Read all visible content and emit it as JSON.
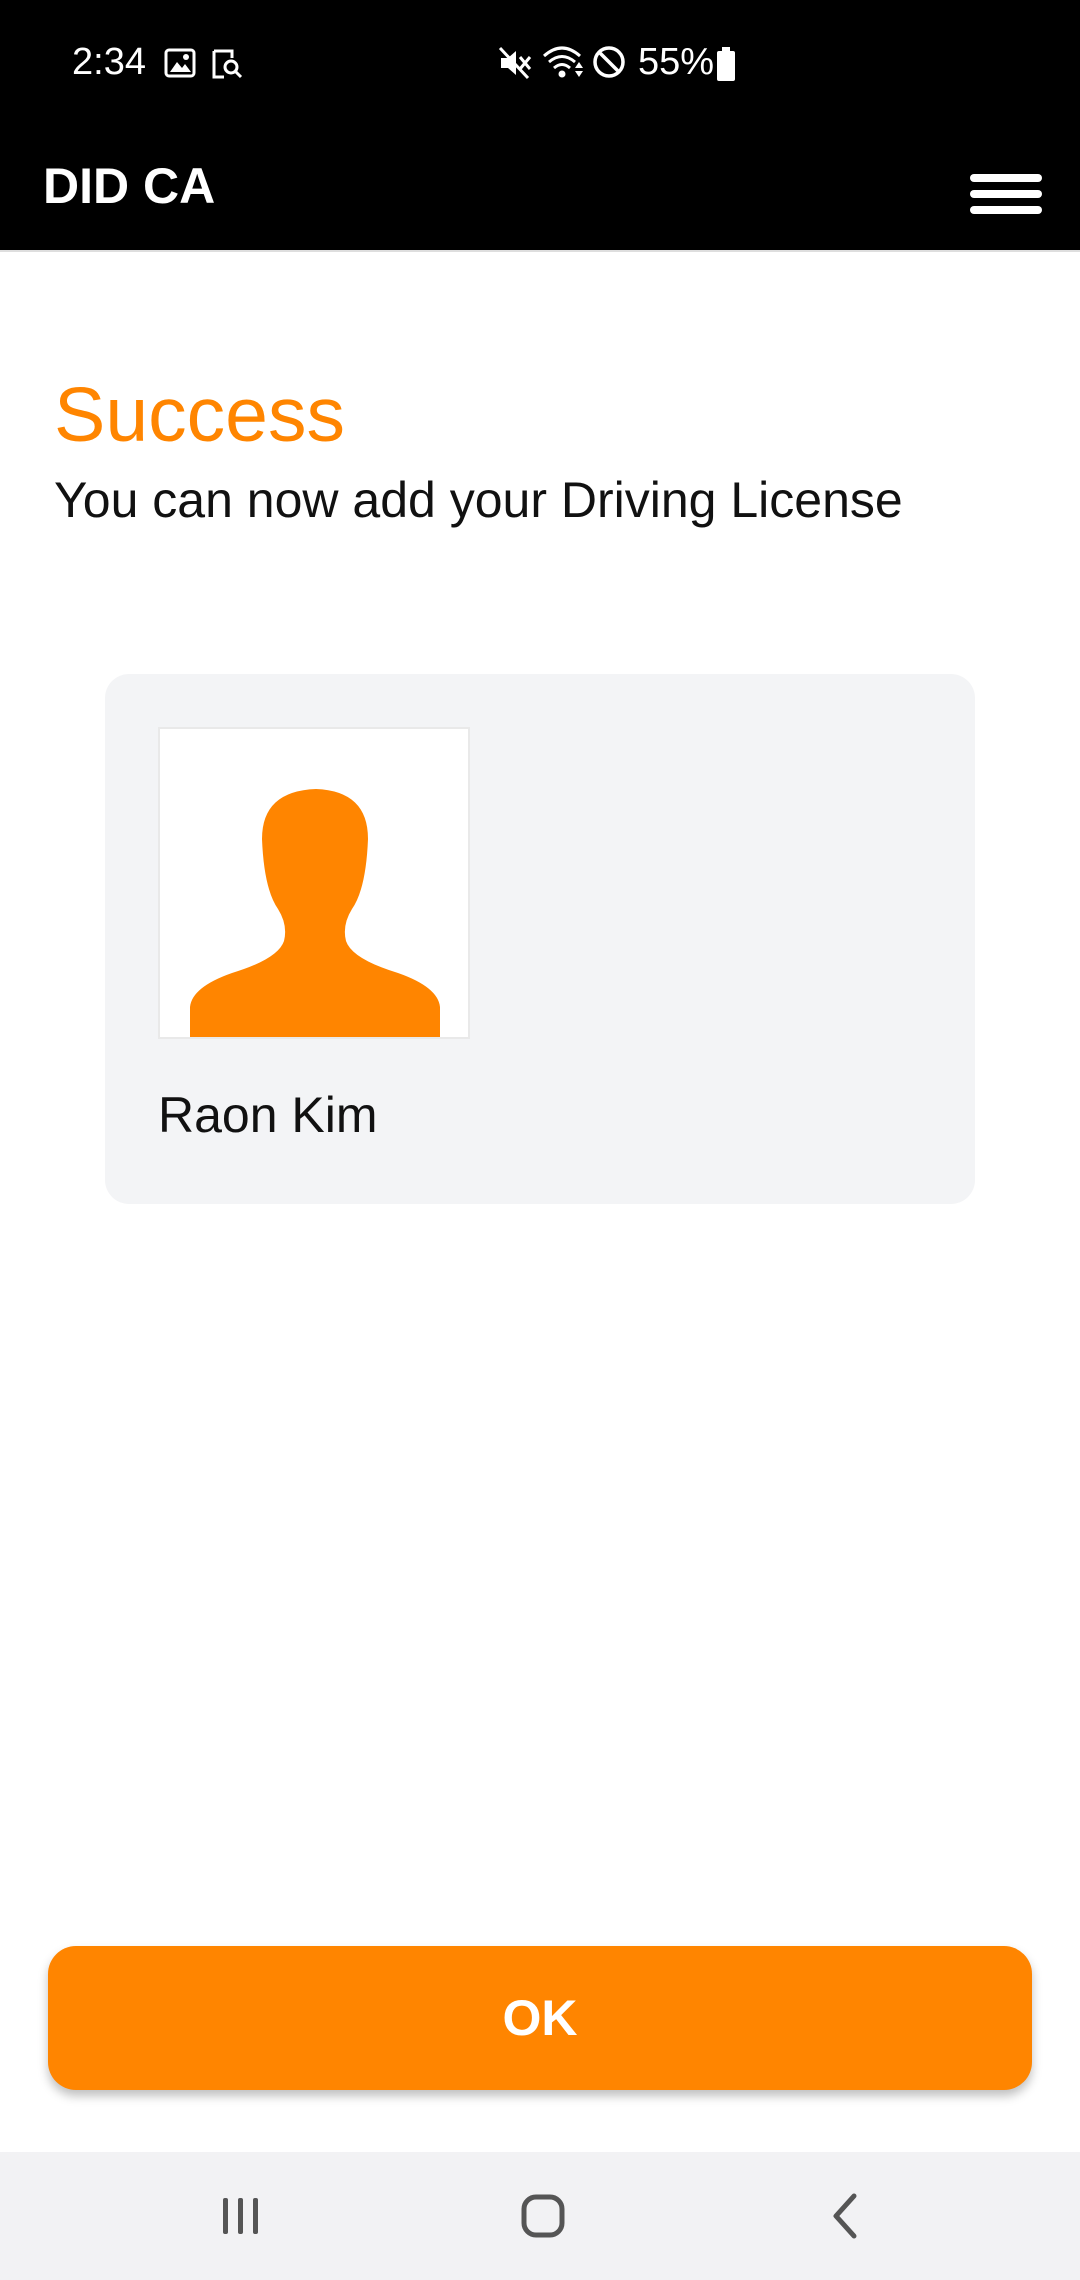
{
  "status_bar": {
    "time": "2:34",
    "battery": "55%",
    "icons": [
      "gallery-icon",
      "screen-search-icon",
      "mute-icon",
      "wifi-icon",
      "do-not-disturb-icon",
      "battery-icon"
    ]
  },
  "app_bar": {
    "title": "DID CA",
    "menu_icon": "hamburger-menu-icon"
  },
  "content": {
    "headline": "Success",
    "subline": "You can now add your Driving License",
    "card": {
      "name": "Raon Kim",
      "avatar_icon": "person-silhouette-icon"
    }
  },
  "actions": {
    "ok_label": "OK"
  },
  "nav_bar": {
    "items": [
      "recent-apps-icon",
      "home-icon",
      "back-icon"
    ]
  },
  "colors": {
    "accent": "#ff8500",
    "bar_background": "#000000",
    "card_background": "#f3f4f6"
  }
}
